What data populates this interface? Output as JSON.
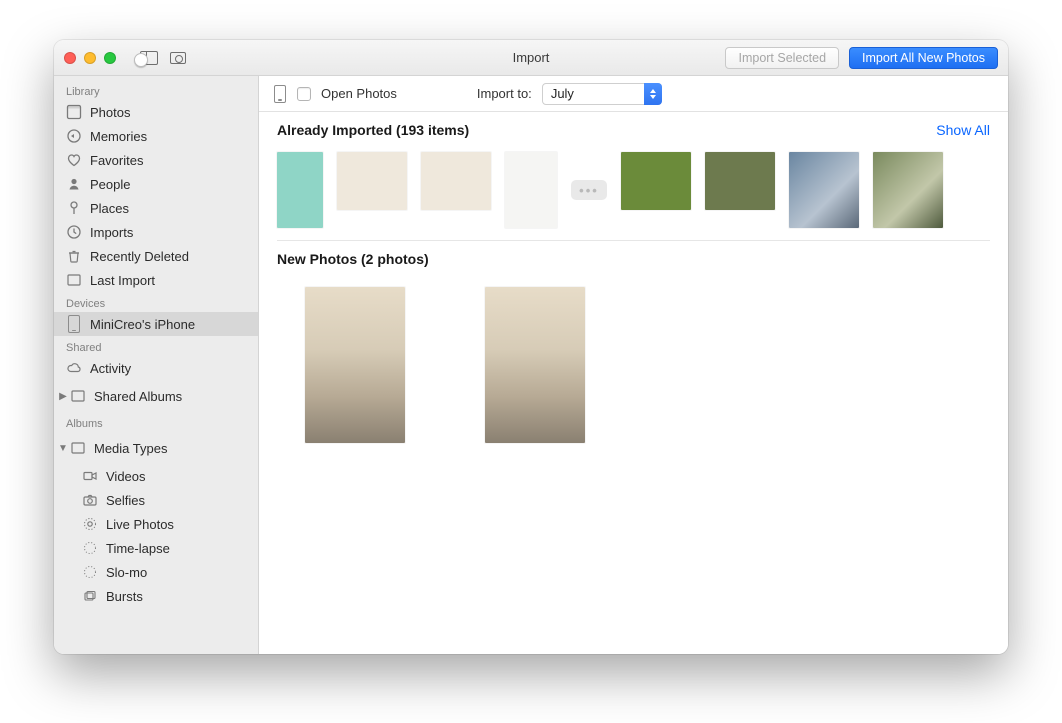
{
  "window": {
    "title": "Import"
  },
  "toolbar": {
    "import_selected_label": "Import Selected",
    "import_all_label": "Import All New Photos"
  },
  "import_bar": {
    "open_photos_label": "Open Photos",
    "import_to_label": "Import to:",
    "import_to_value": "July"
  },
  "sidebar": {
    "sections": {
      "library": "Library",
      "devices": "Devices",
      "shared": "Shared",
      "albums": "Albums"
    },
    "library": {
      "photos": "Photos",
      "memories": "Memories",
      "favorites": "Favorites",
      "people": "People",
      "places": "Places",
      "imports": "Imports",
      "recently_deleted": "Recently Deleted",
      "last_import": "Last Import"
    },
    "devices": {
      "iphone": "MiniCreo's iPhone"
    },
    "shared": {
      "activity": "Activity",
      "shared_albums": "Shared Albums"
    },
    "albums": {
      "media_types": "Media Types",
      "videos": "Videos",
      "selfies": "Selfies",
      "live_photos": "Live Photos",
      "time_lapse": "Time-lapse",
      "slo_mo": "Slo-mo",
      "bursts": "Bursts"
    }
  },
  "content": {
    "already_imported_header": "Already Imported (193 items)",
    "show_all_label": "Show All",
    "new_photos_header": "New Photos (2 photos)"
  }
}
